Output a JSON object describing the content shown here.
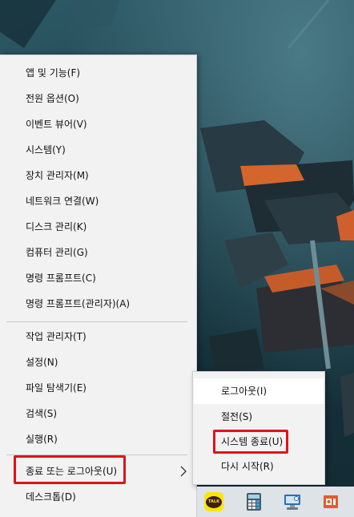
{
  "context_menu": {
    "items": [
      {
        "label": "앱 및 기능(F)"
      },
      {
        "label": "전원 옵션(O)"
      },
      {
        "label": "이벤트 뷰어(V)"
      },
      {
        "label": "시스템(Y)"
      },
      {
        "label": "장치 관리자(M)"
      },
      {
        "label": "네트워크 연결(W)"
      },
      {
        "label": "디스크 관리(K)"
      },
      {
        "label": "컴퓨터 관리(G)"
      },
      {
        "label": "명령 프롬프트(C)"
      },
      {
        "label": "명령 프롬프트(관리자)(A)"
      },
      {
        "label": "작업 관리자(T)"
      },
      {
        "label": "설정(N)"
      },
      {
        "label": "파일 탐색기(E)"
      },
      {
        "label": "검색(S)"
      },
      {
        "label": "실행(R)"
      },
      {
        "label": "종료 또는 로그아웃(U)",
        "highlighted": true,
        "has_submenu": true
      },
      {
        "label": "데스크톱(D)"
      }
    ]
  },
  "shutdown_submenu": {
    "items": [
      {
        "label": "로그아웃(I)",
        "hovered": true
      },
      {
        "label": "절전(S)"
      },
      {
        "label": "시스템 종료(U)",
        "highlighted": true
      },
      {
        "label": "다시 시작(R)"
      }
    ]
  },
  "taskbar": {
    "pinned": [
      {
        "icon": "kakaotalk-icon",
        "badge_text": "TALK"
      },
      {
        "icon": "calculator-icon"
      },
      {
        "icon": "remote-desktop-icon"
      },
      {
        "icon": "powerpoint-icon"
      }
    ]
  },
  "colors": {
    "menu_background": "#f2f2f2",
    "highlight_border": "#e3101b",
    "taskbar_background": "#dde3e6"
  }
}
